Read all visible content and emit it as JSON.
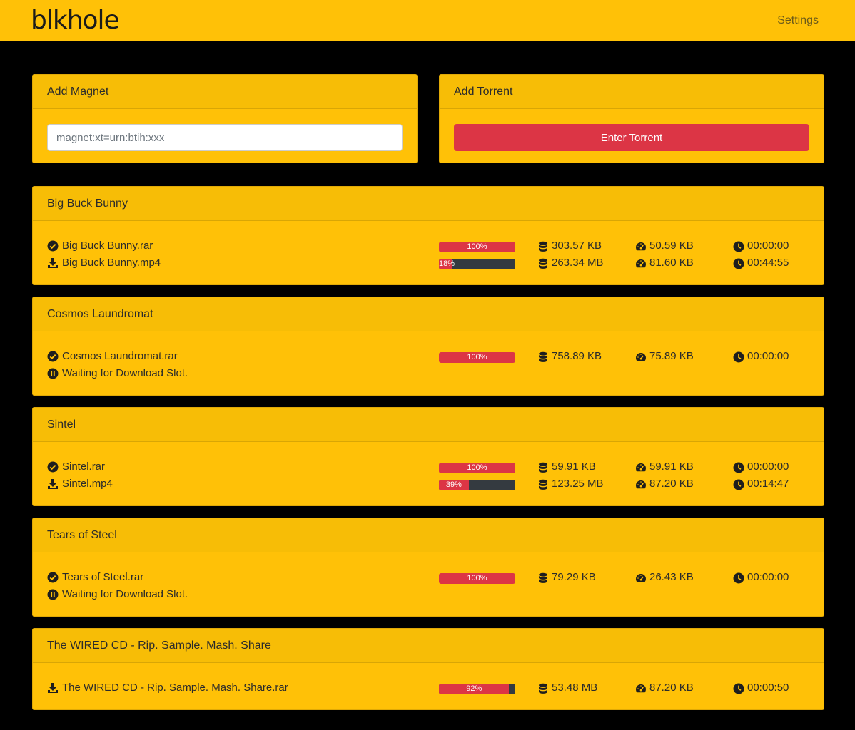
{
  "navbar": {
    "brand": "blkhole",
    "settings_label": "Settings"
  },
  "magnet_card": {
    "title": "Add Magnet",
    "placeholder": "magnet:xt=urn:btih:xxx"
  },
  "torrent_card": {
    "title": "Add Torrent",
    "button_label": "Enter Torrent"
  },
  "torrents": [
    {
      "title": "Big Buck Bunny",
      "files": [
        {
          "status": "complete",
          "status_icon": "check-circle-icon",
          "name": "Big Buck Bunny.rar",
          "progress": 100,
          "progress_label": "100%",
          "size": "303.57 KB",
          "speed": "50.59 KB",
          "time": "00:00:00"
        },
        {
          "status": "downloading",
          "status_icon": "download-icon",
          "name": "Big Buck Bunny.mp4",
          "progress": 18,
          "progress_label": "18%",
          "size": "263.34 MB",
          "speed": "81.60 KB",
          "time": "00:44:55"
        }
      ]
    },
    {
      "title": "Cosmos Laundromat",
      "files": [
        {
          "status": "complete",
          "status_icon": "check-circle-icon",
          "name": "Cosmos Laundromat.rar",
          "progress": 100,
          "progress_label": "100%",
          "size": "758.89 KB",
          "speed": "75.89 KB",
          "time": "00:00:00"
        },
        {
          "status": "waiting",
          "status_icon": "pause-circle-icon",
          "name": "Waiting for Download Slot."
        }
      ]
    },
    {
      "title": "Sintel",
      "files": [
        {
          "status": "complete",
          "status_icon": "check-circle-icon",
          "name": "Sintel.rar",
          "progress": 100,
          "progress_label": "100%",
          "size": "59.91 KB",
          "speed": "59.91 KB",
          "time": "00:00:00"
        },
        {
          "status": "downloading",
          "status_icon": "download-icon",
          "name": "Sintel.mp4",
          "progress": 39,
          "progress_label": "39%",
          "size": "123.25 MB",
          "speed": "87.20 KB",
          "time": "00:14:47"
        }
      ]
    },
    {
      "title": "Tears of Steel",
      "files": [
        {
          "status": "complete",
          "status_icon": "check-circle-icon",
          "name": "Tears of Steel.rar",
          "progress": 100,
          "progress_label": "100%",
          "size": "79.29 KB",
          "speed": "26.43 KB",
          "time": "00:00:00"
        },
        {
          "status": "waiting",
          "status_icon": "pause-circle-icon",
          "name": "Waiting for Download Slot."
        }
      ]
    },
    {
      "title": "The WIRED CD - Rip. Sample. Mash. Share",
      "files": [
        {
          "status": "downloading",
          "status_icon": "download-icon",
          "name": "The WIRED CD - Rip. Sample. Mash. Share.rar",
          "progress": 92,
          "progress_label": "92%",
          "size": "53.48 MB",
          "speed": "87.20 KB",
          "time": "00:00:50"
        }
      ]
    }
  ],
  "colors": {
    "navbar": "#ffc107",
    "card": "#ffc107",
    "card_header": "#f7bd06",
    "accent": "#dc3545",
    "progress_track": "#343a40",
    "background": "#000000"
  }
}
